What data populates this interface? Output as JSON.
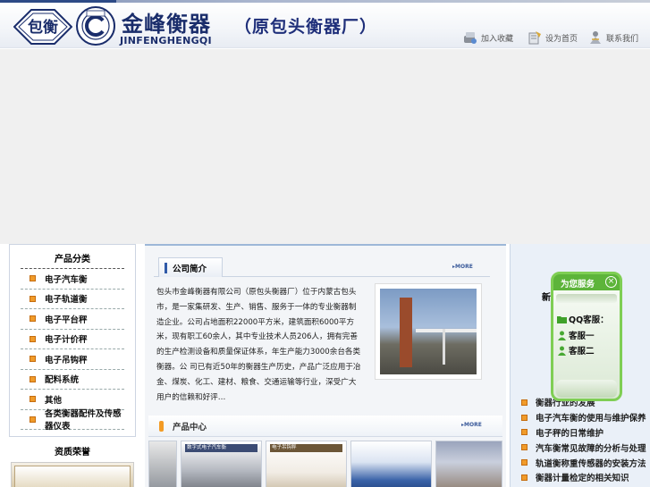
{
  "header": {
    "logo_text": "包衡",
    "brand_cn": "金峰衡器",
    "brand_en": "JINFENGHENGQI",
    "brand_sub": "（原包头衡器厂）",
    "links": [
      {
        "label": "加入收藏",
        "icon": "bookmark-icon"
      },
      {
        "label": "设为首页",
        "icon": "home-page-icon"
      },
      {
        "label": "联系我们",
        "icon": "contact-icon"
      }
    ]
  },
  "left_nav": {
    "title": "产品分类",
    "items": [
      {
        "label": "电子汽车衡"
      },
      {
        "label": "电子轨道衡"
      },
      {
        "label": "电子平台秤"
      },
      {
        "label": "电子计价秤"
      },
      {
        "label": "电子吊钩秤"
      },
      {
        "label": "配料系统"
      },
      {
        "label": "其他"
      },
      {
        "label": "各类衡器配件及传感器仪表"
      }
    ]
  },
  "left_cert": {
    "title": "资质荣誉"
  },
  "about": {
    "tab_label": "公司简介",
    "more_label": "MORE",
    "text": "包头市金峰衡器有限公司（原包头衡器厂）位于内蒙古包头市，是一家集研发、生产、销售、服务于一体的专业衡器制造企业。公司占地面积22000平方米，建筑面积6000平方米，现有职工60余人，其中专业技术人员206人，拥有完善的生产检测设备和质量保证体系，年生产能力3000余台各类衡器。公 司已有近50年的衡器生产历史，产品广泛应用于冶金、煤炭、化工、建材、粮食、交通运输等行业，深受广大用户的信赖和好评…"
  },
  "products": {
    "title": "产品中心",
    "more_label": "MORE",
    "items": [
      {
        "label": ""
      },
      {
        "label": "数字式电子汽车衡"
      },
      {
        "label": "电子吊钩秤"
      },
      {
        "label": ""
      },
      {
        "label": ""
      }
    ]
  },
  "right": {
    "title": "新闻动态",
    "items": [
      {
        "label": "衡器行业的发展"
      },
      {
        "label": "电子汽车衡的使用与维护保养"
      },
      {
        "label": "电子秤的日常维护"
      },
      {
        "label": "汽车衡常见故障的分析与处理"
      },
      {
        "label": "轨道衡称重传感器的安装方法"
      },
      {
        "label": "衡器计量检定的相关知识"
      }
    ]
  },
  "qq_widget": {
    "title": "为您服务",
    "close_glyph": "×",
    "items": [
      {
        "label": "QQ客服：",
        "icon": "qq-folder-icon"
      },
      {
        "label": "客服一",
        "icon": "qq-user-icon"
      },
      {
        "label": "客服二",
        "icon": "qq-user-icon"
      }
    ]
  },
  "colors": {
    "brand_blue": "#1a2d6b",
    "bullet_orange": "#f09b2a",
    "qq_green": "#5db43a"
  }
}
